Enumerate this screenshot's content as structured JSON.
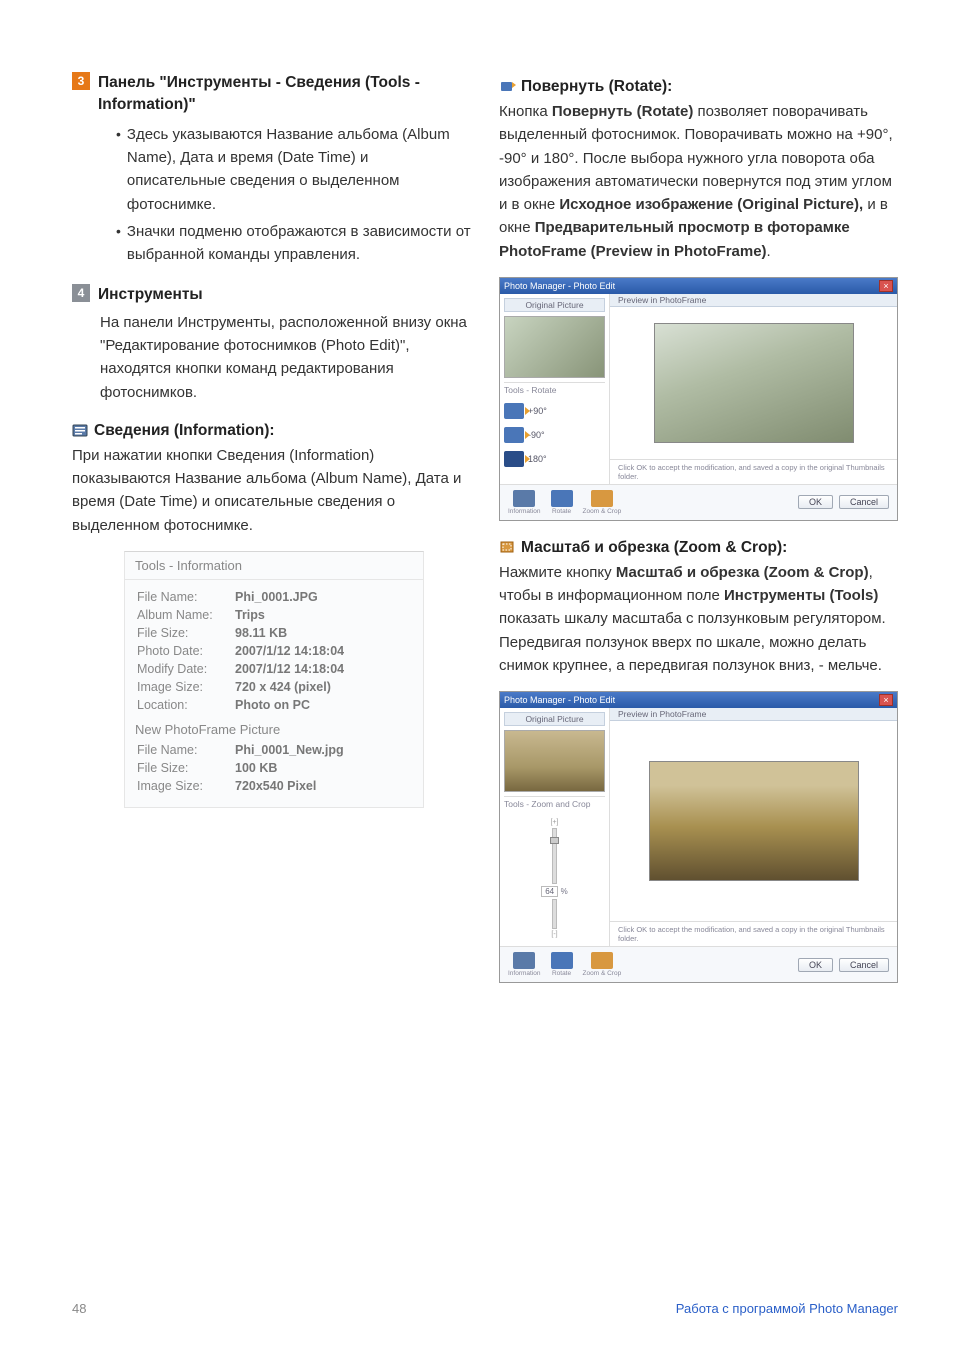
{
  "left": {
    "section3": {
      "number": "3",
      "title": "Панель \"Инструменты - Сведения (Tools - Information)\"",
      "bullets": [
        "Здесь указываются Название альбома (Album Name), Дата и время (Date Time) и описательные сведения о выделенном фотоснимке.",
        "Значки подменю отображаются в зависимости от выбранной команды управления."
      ]
    },
    "section4": {
      "number": "4",
      "title": "Инструменты",
      "para": "На панели Инструменты, расположенной внизу окна \"Редактирование фотоснимков (Photo Edit)\", находятся кнопки команд редактирования фотоснимков."
    },
    "info": {
      "heading": "Сведения (Information):",
      "para": "При нажатии кнопки Сведения (Information) показываются Название альбома (Album Name), Дата и время (Date Time) и описательные сведения о выделенном фотоснимке."
    },
    "toolsPanel": {
      "title": "Tools - Information",
      "rows": [
        {
          "k": "File Name:",
          "v": "Phi_0001.JPG"
        },
        {
          "k": "Album Name:",
          "v": "Trips"
        },
        {
          "k": "File Size:",
          "v": "98.11 KB"
        },
        {
          "k": "Photo Date:",
          "v": "2007/1/12 14:18:04"
        },
        {
          "k": "Modify Date:",
          "v": "2007/1/12 14:18:04"
        },
        {
          "k": "Image Size:",
          "v": "720 x 424 (pixel)"
        },
        {
          "k": "Location:",
          "v": "Photo on PC"
        }
      ],
      "sub": "New PhotoFrame Picture",
      "rows2": [
        {
          "k": "File Name:",
          "v": "Phi_0001_New.jpg"
        },
        {
          "k": "File Size:",
          "v": "100 KB"
        },
        {
          "k": "Image Size:",
          "v": "720x540 Pixel"
        }
      ]
    }
  },
  "right": {
    "rotate": {
      "heading": "Повернуть (Rotate):",
      "p1a": "Кнопка ",
      "p1b": "Повернуть (Rotate)",
      "p1c": " позволяет поворачивать выделенный фотоснимок. Поворачивать можно на +90°, -90° и 180°. После выбора нужного угла поворота оба изображения автоматически повернутся под этим углом и в окне ",
      "p1d": "Исходное изображение (Original Picture),",
      "p1e": " и в окне ",
      "p1f": "Предварительный просмотр в фоторамке PhotoFrame (Preview in PhotoFrame)",
      "p1g": "."
    },
    "shot1": {
      "title": "Photo Manager - Photo Edit",
      "orig": "Original Picture",
      "prev": "Preview in PhotoFrame",
      "toolsLabel": "Tools - Rotate",
      "opts": [
        "+90°",
        "-90°",
        "180°"
      ],
      "hint": "Click OK to accept the modification, and saved a copy in the original Thumbnails folder.",
      "icons": [
        "Information",
        "Rotate",
        "Zoom & Crop"
      ],
      "ok": "OK",
      "cancel": "Cancel"
    },
    "zoom": {
      "heading": "Масштаб и обрезка (Zoom & Crop):",
      "p1a": "Нажмите кнопку ",
      "p1b": "Масштаб и обрезка (Zoom & Crop)",
      "p1c": ", чтобы в информационном поле ",
      "p1d": "Инструменты (Tools)",
      "p1e": " показать шкалу масштаба с ползунковым регулятором. Передвигая ползунок вверх по шкале,  можно делать снимок крупнее, а передвигая ползунок вниз, - мельче."
    },
    "shot2": {
      "title": "Photo Manager - Photo Edit",
      "orig": "Original Picture",
      "prev": "Preview in PhotoFrame",
      "toolsLabel": "Tools - Zoom and Crop",
      "end1": "[+]",
      "end2": "[-]",
      "pct": "64",
      "pctUnit": "%",
      "hint": "Click OK to accept the modification, and saved a copy in the original Thumbnails folder.",
      "icons": [
        "Information",
        "Rotate",
        "Zoom & Crop"
      ],
      "ok": "OK",
      "cancel": "Cancel"
    }
  },
  "footer": {
    "page": "48",
    "section": "Работа с программой Photo Manager"
  }
}
